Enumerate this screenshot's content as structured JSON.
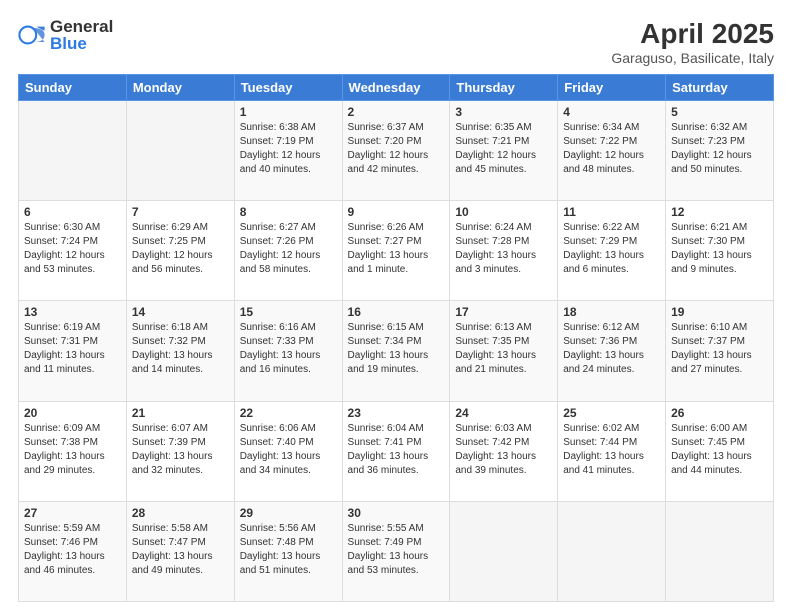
{
  "logo": {
    "general": "General",
    "blue": "Blue"
  },
  "title": "April 2025",
  "subtitle": "Garaguso, Basilicate, Italy",
  "days_header": [
    "Sunday",
    "Monday",
    "Tuesday",
    "Wednesday",
    "Thursday",
    "Friday",
    "Saturday"
  ],
  "weeks": [
    [
      {
        "num": "",
        "info": ""
      },
      {
        "num": "",
        "info": ""
      },
      {
        "num": "1",
        "info": "Sunrise: 6:38 AM\nSunset: 7:19 PM\nDaylight: 12 hours and 40 minutes."
      },
      {
        "num": "2",
        "info": "Sunrise: 6:37 AM\nSunset: 7:20 PM\nDaylight: 12 hours and 42 minutes."
      },
      {
        "num": "3",
        "info": "Sunrise: 6:35 AM\nSunset: 7:21 PM\nDaylight: 12 hours and 45 minutes."
      },
      {
        "num": "4",
        "info": "Sunrise: 6:34 AM\nSunset: 7:22 PM\nDaylight: 12 hours and 48 minutes."
      },
      {
        "num": "5",
        "info": "Sunrise: 6:32 AM\nSunset: 7:23 PM\nDaylight: 12 hours and 50 minutes."
      }
    ],
    [
      {
        "num": "6",
        "info": "Sunrise: 6:30 AM\nSunset: 7:24 PM\nDaylight: 12 hours and 53 minutes."
      },
      {
        "num": "7",
        "info": "Sunrise: 6:29 AM\nSunset: 7:25 PM\nDaylight: 12 hours and 56 minutes."
      },
      {
        "num": "8",
        "info": "Sunrise: 6:27 AM\nSunset: 7:26 PM\nDaylight: 12 hours and 58 minutes."
      },
      {
        "num": "9",
        "info": "Sunrise: 6:26 AM\nSunset: 7:27 PM\nDaylight: 13 hours and 1 minute."
      },
      {
        "num": "10",
        "info": "Sunrise: 6:24 AM\nSunset: 7:28 PM\nDaylight: 13 hours and 3 minutes."
      },
      {
        "num": "11",
        "info": "Sunrise: 6:22 AM\nSunset: 7:29 PM\nDaylight: 13 hours and 6 minutes."
      },
      {
        "num": "12",
        "info": "Sunrise: 6:21 AM\nSunset: 7:30 PM\nDaylight: 13 hours and 9 minutes."
      }
    ],
    [
      {
        "num": "13",
        "info": "Sunrise: 6:19 AM\nSunset: 7:31 PM\nDaylight: 13 hours and 11 minutes."
      },
      {
        "num": "14",
        "info": "Sunrise: 6:18 AM\nSunset: 7:32 PM\nDaylight: 13 hours and 14 minutes."
      },
      {
        "num": "15",
        "info": "Sunrise: 6:16 AM\nSunset: 7:33 PM\nDaylight: 13 hours and 16 minutes."
      },
      {
        "num": "16",
        "info": "Sunrise: 6:15 AM\nSunset: 7:34 PM\nDaylight: 13 hours and 19 minutes."
      },
      {
        "num": "17",
        "info": "Sunrise: 6:13 AM\nSunset: 7:35 PM\nDaylight: 13 hours and 21 minutes."
      },
      {
        "num": "18",
        "info": "Sunrise: 6:12 AM\nSunset: 7:36 PM\nDaylight: 13 hours and 24 minutes."
      },
      {
        "num": "19",
        "info": "Sunrise: 6:10 AM\nSunset: 7:37 PM\nDaylight: 13 hours and 27 minutes."
      }
    ],
    [
      {
        "num": "20",
        "info": "Sunrise: 6:09 AM\nSunset: 7:38 PM\nDaylight: 13 hours and 29 minutes."
      },
      {
        "num": "21",
        "info": "Sunrise: 6:07 AM\nSunset: 7:39 PM\nDaylight: 13 hours and 32 minutes."
      },
      {
        "num": "22",
        "info": "Sunrise: 6:06 AM\nSunset: 7:40 PM\nDaylight: 13 hours and 34 minutes."
      },
      {
        "num": "23",
        "info": "Sunrise: 6:04 AM\nSunset: 7:41 PM\nDaylight: 13 hours and 36 minutes."
      },
      {
        "num": "24",
        "info": "Sunrise: 6:03 AM\nSunset: 7:42 PM\nDaylight: 13 hours and 39 minutes."
      },
      {
        "num": "25",
        "info": "Sunrise: 6:02 AM\nSunset: 7:44 PM\nDaylight: 13 hours and 41 minutes."
      },
      {
        "num": "26",
        "info": "Sunrise: 6:00 AM\nSunset: 7:45 PM\nDaylight: 13 hours and 44 minutes."
      }
    ],
    [
      {
        "num": "27",
        "info": "Sunrise: 5:59 AM\nSunset: 7:46 PM\nDaylight: 13 hours and 46 minutes."
      },
      {
        "num": "28",
        "info": "Sunrise: 5:58 AM\nSunset: 7:47 PM\nDaylight: 13 hours and 49 minutes."
      },
      {
        "num": "29",
        "info": "Sunrise: 5:56 AM\nSunset: 7:48 PM\nDaylight: 13 hours and 51 minutes."
      },
      {
        "num": "30",
        "info": "Sunrise: 5:55 AM\nSunset: 7:49 PM\nDaylight: 13 hours and 53 minutes."
      },
      {
        "num": "",
        "info": ""
      },
      {
        "num": "",
        "info": ""
      },
      {
        "num": "",
        "info": ""
      }
    ]
  ]
}
